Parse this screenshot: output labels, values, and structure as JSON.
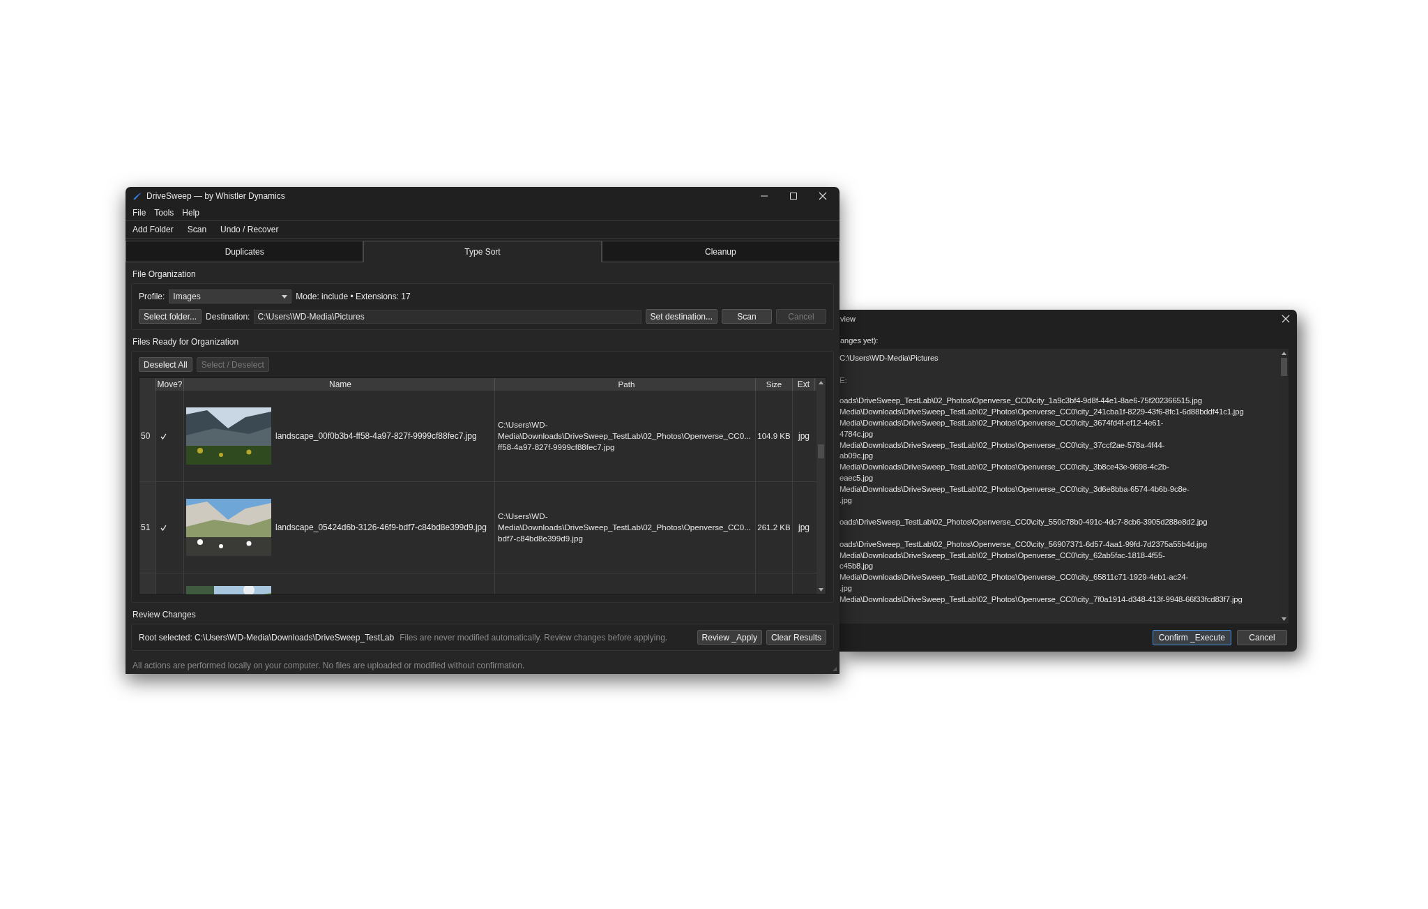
{
  "main_window": {
    "title": "DriveSweep — by Whistler Dynamics",
    "menu": [
      "File",
      "Tools",
      "Help"
    ],
    "toolbar": [
      "Add Folder",
      "Scan",
      "Undo / Recover"
    ],
    "tabs": [
      {
        "label": "Duplicates",
        "selected": false
      },
      {
        "label": "Type Sort",
        "selected": true
      },
      {
        "label": "Cleanup",
        "selected": false
      }
    ],
    "file_organization": {
      "heading": "File Organization",
      "profile_label": "Profile:",
      "profile": "Images",
      "mode_info": "Mode: include • Extensions: 17",
      "buttons": [
        {
          "label": "Select folder...",
          "disabled": false
        }
      ],
      "destination_label": "Destination:",
      "destination": "C:\\Users\\WD-Media\\Pictures",
      "actions": [
        {
          "label": "Set destination...",
          "disabled": false
        },
        {
          "label": "Scan",
          "disabled": false
        },
        {
          "label": "Cancel",
          "disabled": true
        }
      ]
    },
    "files_ready": {
      "heading": "Files Ready for Organization",
      "buttons": [
        {
          "label": "Deselect All",
          "disabled": false
        },
        {
          "label": "Select / Deselect",
          "disabled": true
        }
      ],
      "table": {
        "columns": [
          "Move?",
          "Name",
          "Path",
          "Size",
          "Ext"
        ],
        "rows": [
          {
            "number": "50",
            "checked": true,
            "name": "landscape_00f0b3b4-ff58-4a97-827f-9999cf88fec7.jpg",
            "path": [
              "C:\\Users\\WD-",
              "Media\\Downloads\\DriveSweep_TestLab\\02_Photos\\Openverse_CC0...",
              "ff58-4a97-827f-9999cf88fec7.jpg"
            ],
            "size": "104.9 KB",
            "ext": "jpg"
          },
          {
            "number": "51",
            "checked": true,
            "name": "landscape_05424d6b-3126-46f9-bdf7-c84bd8e399d9.jpg",
            "path": [
              "C:\\Users\\WD-",
              "Media\\Downloads\\DriveSweep_TestLab\\02_Photos\\Openverse_CC0...",
              "bdf7-c84bd8e399d9.jpg"
            ],
            "size": "261.2 KB",
            "ext": "jpg"
          }
        ]
      }
    },
    "review_changes": {
      "heading": "Review Changes",
      "root": "Root selected: C:\\Users\\WD-Media\\Downloads\\DriveSweep_TestLab",
      "note": "Files are never modified automatically. Review changes before applying.",
      "buttons": [
        {
          "label": "Review _Apply",
          "disabled": false
        },
        {
          "label": "Clear Results",
          "disabled": false
        }
      ]
    },
    "footer": "All actions are performed locally on your computer. No files are uploaded or modified without confirmation."
  },
  "review_dialog": {
    "title": "view",
    "intro": "anges yet):",
    "destination": "C:\\Users\\WD-Media\\Pictures",
    "section": "E:",
    "groups": [
      {
        "lines": [
          {
            "text": "oads\\DriveSweep_TestLab\\02_Photos\\Openverse_CC0\\city_1a9c3bf4-9d8f-44e1-8ae6-75f202366515.jpg"
          },
          {
            "text": "Media\\Downloads\\DriveSweep_TestLab\\02_Photos\\Openverse_CC0\\city_241cba1f-8229-43f6-8fc1-6d88bddf41c1.jpg"
          },
          {
            "text": "Media\\Downloads\\DriveSweep_TestLab\\02_Photos\\Openverse_CC0\\city_3674fd4f-ef12-4e61-",
            "cont": "4784c.jpg"
          },
          {
            "text": "Media\\Downloads\\DriveSweep_TestLab\\02_Photos\\Openverse_CC0\\city_37ccf2ae-578a-4f44-",
            "cont": "ab09c.jpg"
          },
          {
            "text": "Media\\Downloads\\DriveSweep_TestLab\\02_Photos\\Openverse_CC0\\city_3b8ce43e-9698-4c2b-",
            "cont": "eaec5.jpg"
          },
          {
            "text": "Media\\Downloads\\DriveSweep_TestLab\\02_Photos\\Openverse_CC0\\city_3d6e8bba-6574-4b6b-9c8e-",
            "cont": ".jpg"
          }
        ]
      },
      {
        "lines": [
          {
            "text": "oads\\DriveSweep_TestLab\\02_Photos\\Openverse_CC0\\city_550c78b0-491c-4dc7-8cb6-3905d288e8d2.jpg"
          }
        ]
      },
      {
        "lines": [
          {
            "text": "oads\\DriveSweep_TestLab\\02_Photos\\Openverse_CC0\\city_56907371-6d57-4aa1-99fd-7d2375a55b4d.jpg"
          },
          {
            "text": "Media\\Downloads\\DriveSweep_TestLab\\02_Photos\\Openverse_CC0\\city_62ab5fac-1818-4f55-",
            "cont": "c45b8.jpg"
          },
          {
            "text": "Media\\Downloads\\DriveSweep_TestLab\\02_Photos\\Openverse_CC0\\city_65811c71-1929-4eb1-ac24-",
            "cont": ".jpg"
          },
          {
            "text": "Media\\Downloads\\DriveSweep_TestLab\\02_Photos\\Openverse_CC0\\city_7f0a1914-d348-413f-9948-66f33fcd83f7.jpg"
          }
        ]
      }
    ],
    "buttons": [
      {
        "label": "Confirm _Execute",
        "default": true
      },
      {
        "label": "Cancel",
        "default": false
      }
    ]
  }
}
